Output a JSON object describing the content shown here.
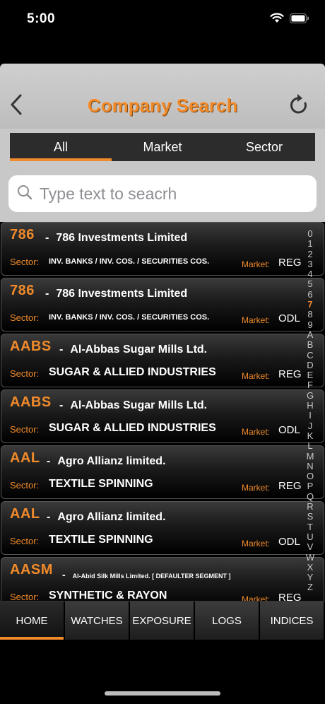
{
  "status": {
    "time": "5:00",
    "icons": [
      "wifi-icon",
      "battery-icon"
    ]
  },
  "nav": {
    "title": "Company Search",
    "back_icon": "chevron-left-icon",
    "refresh_icon": "refresh-icon"
  },
  "segments": [
    {
      "label": "All",
      "active": true
    },
    {
      "label": "Market",
      "active": false
    },
    {
      "label": "Sector",
      "active": false
    }
  ],
  "search": {
    "placeholder": "Type text to seacrh",
    "value": ""
  },
  "labels": {
    "sector": "Sector:",
    "market": "Market:",
    "dash": "-"
  },
  "companies": [
    {
      "symbol": "786",
      "name": "786 Investments Limited",
      "sector": "INV. BANKS / INV. COS. / SECURITIES COS.",
      "market": "REG"
    },
    {
      "symbol": "786",
      "name": "786 Investments Limited",
      "sector": "INV. BANKS / INV. COS. / SECURITIES COS.",
      "market": "ODL"
    },
    {
      "symbol": "AABS",
      "name": "Al-Abbas Sugar Mills Ltd.",
      "sector": "SUGAR & ALLIED INDUSTRIES",
      "market": "REG"
    },
    {
      "symbol": "AABS",
      "name": "Al-Abbas Sugar Mills Ltd.",
      "sector": "SUGAR & ALLIED INDUSTRIES",
      "market": "ODL"
    },
    {
      "symbol": "AAL",
      "name": "Agro Allianz limited.",
      "sector": "TEXTILE SPINNING",
      "market": "REG"
    },
    {
      "symbol": "AAL",
      "name": "Agro Allianz limited.",
      "sector": "TEXTILE SPINNING",
      "market": "ODL"
    },
    {
      "symbol": "AASM",
      "name": "Al-Abid Silk Mills Limited. [ DEFAULTER SEGMENT ]",
      "sector": "SYNTHETIC & RAYON",
      "market": "REG"
    }
  ],
  "index": [
    "0",
    "1",
    "2",
    "3",
    "4",
    "5",
    "6",
    "7",
    "8",
    "9",
    "A",
    "B",
    "C",
    "D",
    "E",
    "F",
    "G",
    "H",
    "I",
    "J",
    "K",
    "L",
    "M",
    "N",
    "O",
    "P",
    "Q",
    "R",
    "S",
    "T",
    "U",
    "V",
    "W",
    "X",
    "Y",
    "Z"
  ],
  "index_active": "7",
  "tabs": [
    {
      "label": "HOME",
      "active": true
    },
    {
      "label": "WATCHES",
      "active": false
    },
    {
      "label": "EXPOSURE",
      "active": false
    },
    {
      "label": "LOGS",
      "active": false
    },
    {
      "label": "INDICES",
      "active": false
    }
  ],
  "colors": {
    "accent": "#f08a2a",
    "header_bg": "#c8c8c8",
    "card_bg": "#000000"
  }
}
